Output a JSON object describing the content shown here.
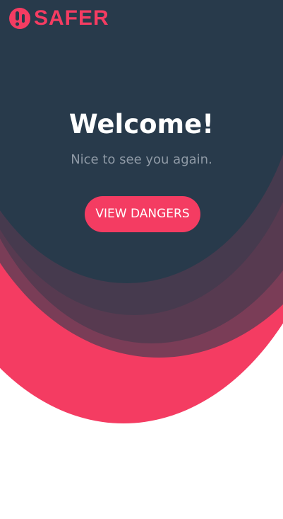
{
  "brand": {
    "name": "SAFER",
    "logo_icon": "exclamation-badge-icon",
    "color": "#f43c62"
  },
  "hero": {
    "title": "Welcome!",
    "subtitle": "Nice to see you again.",
    "subtitle_color": "#8f9aa6"
  },
  "cta": {
    "label": "VIEW DANGERS",
    "color": "#f43c62"
  },
  "colors": {
    "navy": "#283a4b",
    "pink": "#f43c62",
    "wave_mid": "#5e3a52",
    "wave_dark": "#4a3a4e",
    "background": "#ffffff"
  }
}
